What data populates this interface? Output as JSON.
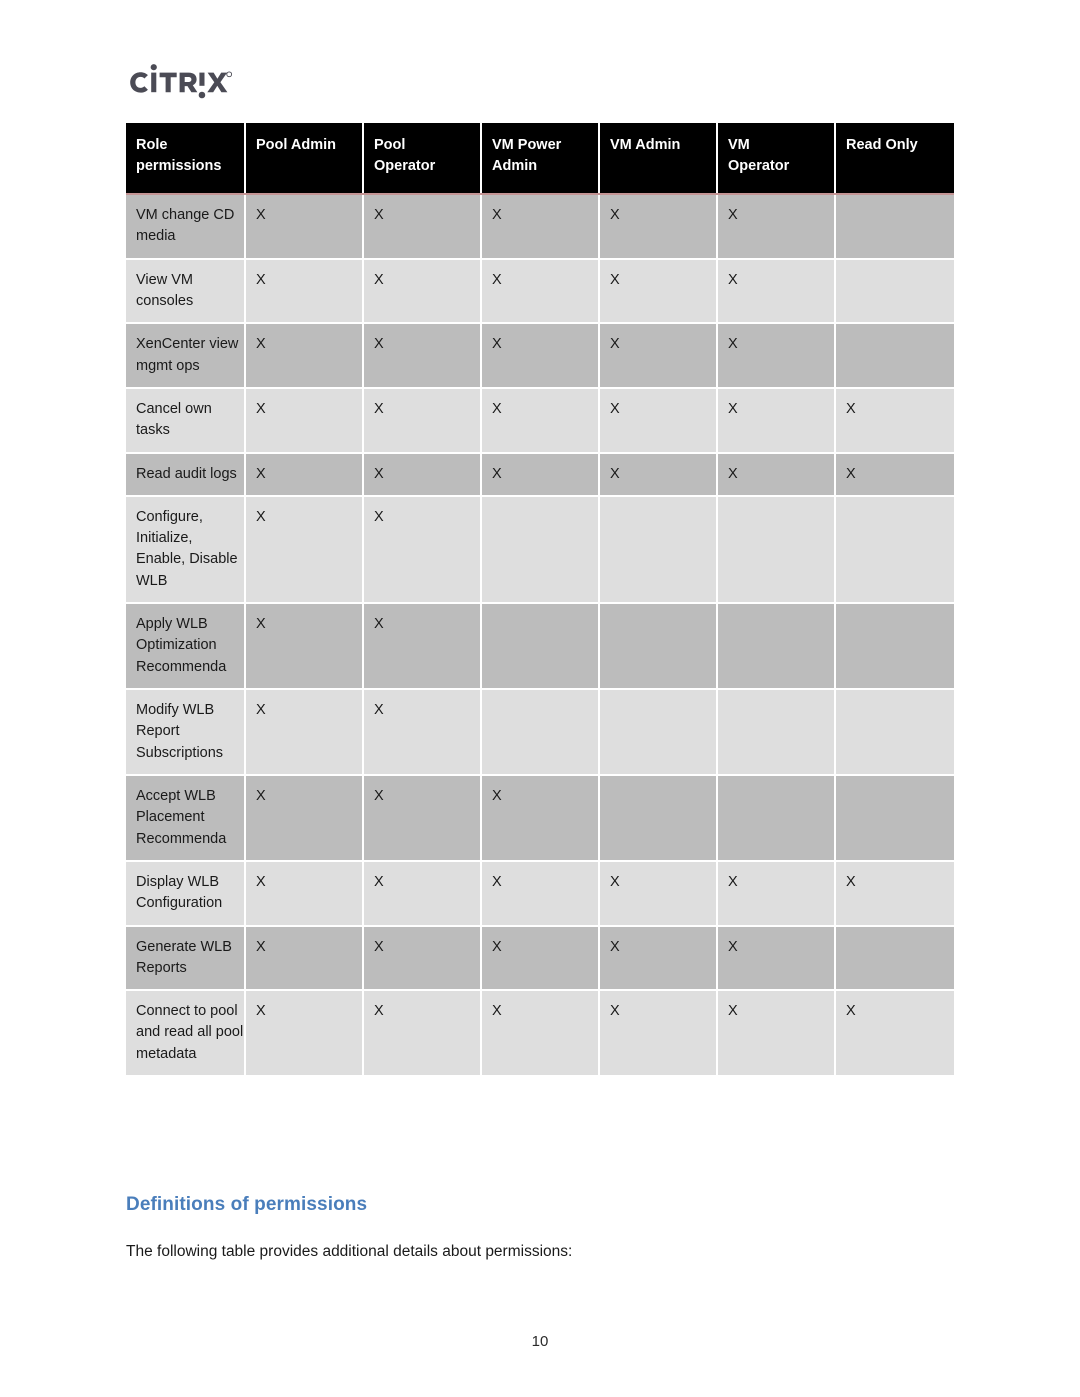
{
  "brand": {
    "logo_name": "citrix-logo",
    "logo_text": "CITRIX",
    "logo_color": "#4b4b55"
  },
  "table": {
    "name": "role-permissions-table",
    "header_bg": "#000000",
    "header_text_color": "#ffffff",
    "row_dark_bg": "#bcbcbc",
    "row_light_bg": "#dedede",
    "header_underline_color": "#c49494",
    "mark": "X",
    "columns": [
      "Role permissions",
      "Pool Admin",
      "Pool Operator",
      "VM Power Admin",
      "VM Admin",
      "VM Operator",
      "Read Only"
    ],
    "rows": [
      {
        "permission": "VM change CD media",
        "marks": [
          true,
          true,
          true,
          true,
          true,
          false
        ]
      },
      {
        "permission": "View VM consoles",
        "marks": [
          true,
          true,
          true,
          true,
          true,
          false
        ]
      },
      {
        "permission": "XenCenter view mgmt ops",
        "marks": [
          true,
          true,
          true,
          true,
          true,
          false
        ]
      },
      {
        "permission": "Cancel own tasks",
        "marks": [
          true,
          true,
          true,
          true,
          true,
          true
        ]
      },
      {
        "permission": "Read audit logs",
        "marks": [
          true,
          true,
          true,
          true,
          true,
          true
        ]
      },
      {
        "permission": "Configure, Initialize, Enable, Disable WLB",
        "marks": [
          true,
          true,
          false,
          false,
          false,
          false
        ]
      },
      {
        "permission": "Apply WLB Optimization Recommenda",
        "marks": [
          true,
          true,
          false,
          false,
          false,
          false
        ]
      },
      {
        "permission": "Modify WLB Report Subscriptions",
        "marks": [
          true,
          true,
          false,
          false,
          false,
          false
        ]
      },
      {
        "permission": "Accept WLB Placement Recommenda",
        "marks": [
          true,
          true,
          true,
          false,
          false,
          false
        ]
      },
      {
        "permission": "Display WLB Configuration",
        "marks": [
          true,
          true,
          true,
          true,
          true,
          true
        ]
      },
      {
        "permission": "Generate WLB Reports",
        "marks": [
          true,
          true,
          true,
          true,
          true,
          false
        ]
      },
      {
        "permission": "Connect to pool and read all pool metadata",
        "marks": [
          true,
          true,
          true,
          true,
          true,
          true
        ]
      }
    ]
  },
  "section": {
    "heading": "Definitions of permissions",
    "heading_color": "#4a7ebb",
    "paragraph": "The following table provides additional details about permissions:"
  },
  "footer": {
    "page_number": "10"
  }
}
